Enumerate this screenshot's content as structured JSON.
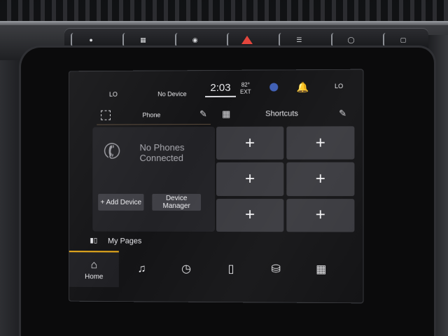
{
  "hardware": {
    "buttons": [
      "",
      "",
      "",
      "",
      "",
      "",
      "",
      ""
    ]
  },
  "status_bar": {
    "temp_left": "LO",
    "device_status": "No Device",
    "time": "2:03",
    "ext_temp": "82°",
    "ext_label": "EXT",
    "temp_right": "LO"
  },
  "phone_panel": {
    "title": "Phone",
    "message": "No Phones Connected",
    "add_device_label": "+ Add Device",
    "device_manager_label": "Device Manager"
  },
  "shortcuts": {
    "title": "Shortcuts",
    "cells": [
      "+",
      "+",
      "+",
      "+",
      "+",
      "+"
    ]
  },
  "mypages": {
    "label": "My Pages"
  },
  "nav": {
    "home_label": "Home"
  },
  "icons": {
    "phone_off": "phone-off-icon",
    "pencil": "pencil-icon",
    "grid": "grid-icon",
    "bell": "bell-icon",
    "home": "home-icon",
    "music": "music-note-icon",
    "gauge": "gauge-icon",
    "phone": "phone-icon",
    "car": "car-icon",
    "apps": "apps-grid-icon"
  },
  "colors": {
    "accent": "#f3b21a",
    "hazard": "#e4463d"
  }
}
